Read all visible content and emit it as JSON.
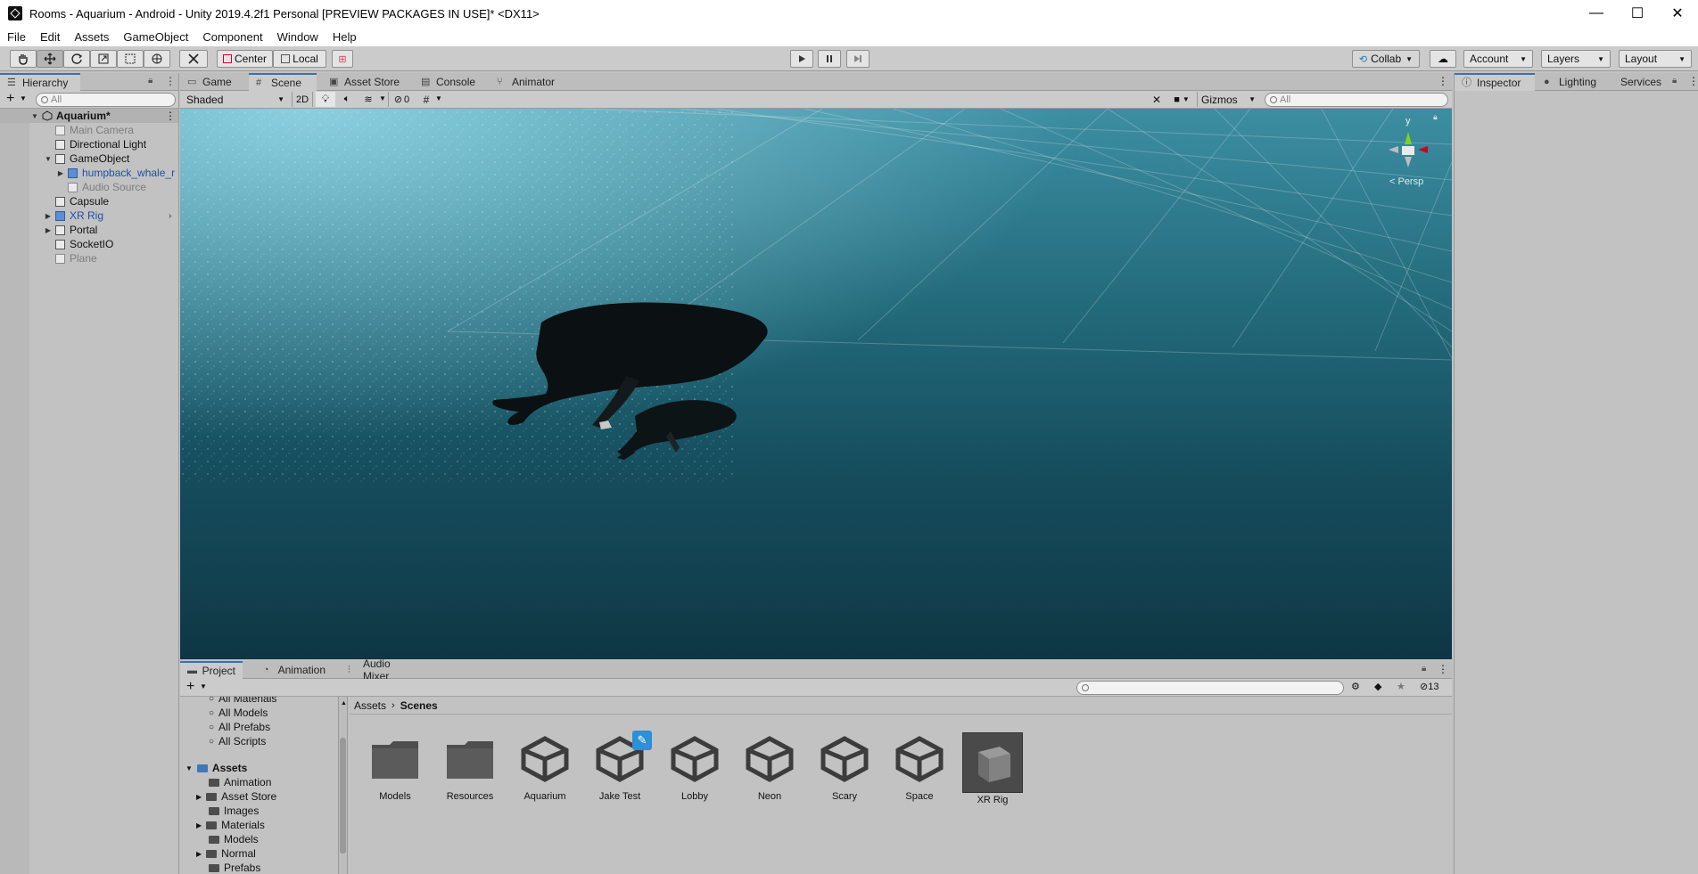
{
  "window": {
    "title": "Rooms - Aquarium - Android - Unity 2019.4.2f1 Personal [PREVIEW PACKAGES IN USE]* <DX11>",
    "minimize": "—",
    "maximize": "☐",
    "close": "✕"
  },
  "menu": [
    "File",
    "Edit",
    "Assets",
    "GameObject",
    "Component",
    "Window",
    "Help"
  ],
  "toolbar": {
    "pivot_mode": "Center",
    "pivot_rotation": "Local",
    "collab": "Collab",
    "account": "Account",
    "layers": "Layers",
    "layout": "Layout"
  },
  "hierarchy": {
    "tab": "Hierarchy",
    "add": "+",
    "search_placeholder": "All",
    "scene_name": "Aquarium*",
    "items": [
      {
        "label": "Main Camera",
        "state": "disabled"
      },
      {
        "label": "Directional Light",
        "state": "normal"
      },
      {
        "label": "GameObject",
        "state": "normal"
      },
      {
        "label": "humpback_whale_r",
        "state": "prefab"
      },
      {
        "label": "Audio Source",
        "state": "disabled"
      },
      {
        "label": "Capsule",
        "state": "normal"
      },
      {
        "label": "XR Rig",
        "state": "prefab"
      },
      {
        "label": "Portal",
        "state": "normal"
      },
      {
        "label": "SocketIO",
        "state": "normal"
      },
      {
        "label": "Plane",
        "state": "disabled"
      }
    ]
  },
  "scene_tabs": [
    "Game",
    "Scene",
    "Asset Store",
    "Console",
    "Animator"
  ],
  "scene_toolbar": {
    "draw_mode": "Shaded",
    "mode_2d": "2D",
    "hidden_count": "0",
    "gizmos": "Gizmos",
    "search_placeholder": "All"
  },
  "scene_gizmo": {
    "axis_y": "y",
    "projection": "< Persp"
  },
  "inspector_tabs": [
    "Inspector",
    "Lighting",
    "Services"
  ],
  "project": {
    "tabs": [
      "Project",
      "Animation",
      "Audio Mixer"
    ],
    "add": "+",
    "hidden_count": "13",
    "favorites": [
      "All Materials",
      "All Models",
      "All Prefabs",
      "All Scripts"
    ],
    "root": "Assets",
    "folders": [
      "Animation",
      "Asset Store",
      "Images",
      "Materials",
      "Models",
      "Normal",
      "Prefabs"
    ],
    "breadcrumb": {
      "root": "Assets",
      "current": "Scenes"
    },
    "assets": [
      {
        "label": "Models",
        "type": "folder"
      },
      {
        "label": "Resources",
        "type": "folder"
      },
      {
        "label": "Aquarium",
        "type": "scene"
      },
      {
        "label": "Jake Test",
        "type": "scene"
      },
      {
        "label": "Lobby",
        "type": "scene"
      },
      {
        "label": "Neon",
        "type": "scene"
      },
      {
        "label": "Scary",
        "type": "scene"
      },
      {
        "label": "Space",
        "type": "scene"
      },
      {
        "label": "XR Rig",
        "type": "prefab"
      }
    ]
  },
  "colors": {
    "accent": "#3a72b0",
    "prefab_text": "#1e4fa8",
    "water_top": "#3d8ea2",
    "water_bottom": "#123f4e"
  }
}
